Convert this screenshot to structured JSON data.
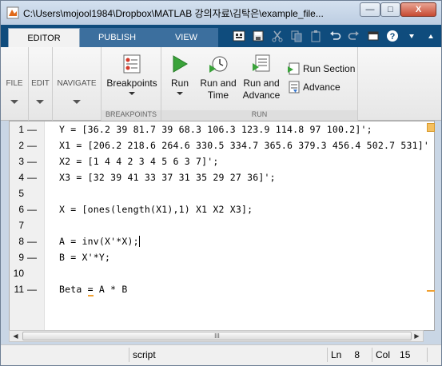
{
  "window": {
    "title": "C:\\Users\\mojool1984\\Dropbox\\MATLAB 강의자료\\김탁은\\example_file...",
    "minimize_glyph": "—",
    "maximize_glyph": "□",
    "close_glyph": "X"
  },
  "tabs": [
    {
      "label": "EDITOR",
      "active": true
    },
    {
      "label": "PUBLISH",
      "active": false
    },
    {
      "label": "VIEW",
      "active": false
    }
  ],
  "quick_access": [
    "grid-icon",
    "save-icon",
    "cut-icon",
    "copy-icon",
    "paste-icon",
    "undo-icon",
    "redo-icon",
    "window-icon",
    "help-icon",
    "overflow-icon",
    "expand-icon"
  ],
  "ribbon": {
    "file": "FILE",
    "edit": "EDIT",
    "navigate": "NAVIGATE",
    "breakpoints_button": "Breakpoints",
    "breakpoints_group": "BREAKPOINTS",
    "run": "Run",
    "run_and_time_1": "Run and",
    "run_and_time_2": "Time",
    "run_and_advance_1": "Run and",
    "run_and_advance_2": "Advance",
    "run_section": "Run Section",
    "advance": "Advance",
    "run_group": "RUN"
  },
  "code_lines": [
    {
      "n": "1",
      "dash": "—",
      "text": "Y = [36.2 39 81.7 39 68.3 106.3 123.9 114.8 97 100.2]';"
    },
    {
      "n": "2",
      "dash": "—",
      "text": "X1 = [206.2 218.6 264.6 330.5 334.7 365.6 379.3 456.4 502.7 531]'"
    },
    {
      "n": "3",
      "dash": "—",
      "text": "X2 = [1 4 4 2 3 4 5 6 3 7]';"
    },
    {
      "n": "4",
      "dash": "—",
      "text": "X3 = [32 39 41 33 37 31 35 29 27 36]';"
    },
    {
      "n": "5",
      "dash": "",
      "text": ""
    },
    {
      "n": "6",
      "dash": "—",
      "text": "X = [ones(length(X1),1) X1 X2 X3];"
    },
    {
      "n": "7",
      "dash": "",
      "text": ""
    },
    {
      "n": "8",
      "dash": "—",
      "text": "A = inv(X'*X);"
    },
    {
      "n": "9",
      "dash": "—",
      "text": "B = X'*Y;"
    },
    {
      "n": "10",
      "dash": "",
      "text": ""
    },
    {
      "n": "11",
      "dash": "—",
      "text": "Beta = A * B"
    }
  ],
  "scrollbar": {
    "thumb_grip": "III",
    "left_arrow": "◀",
    "right_arrow": "▶"
  },
  "status": {
    "file_type": "script",
    "ln_label": "Ln",
    "ln_value": "8",
    "col_label": "Col",
    "col_value": "15"
  },
  "colors": {
    "tab_bar": "#0f4c7d",
    "warning": "#f0a030",
    "run_green": "#3aa33a"
  }
}
